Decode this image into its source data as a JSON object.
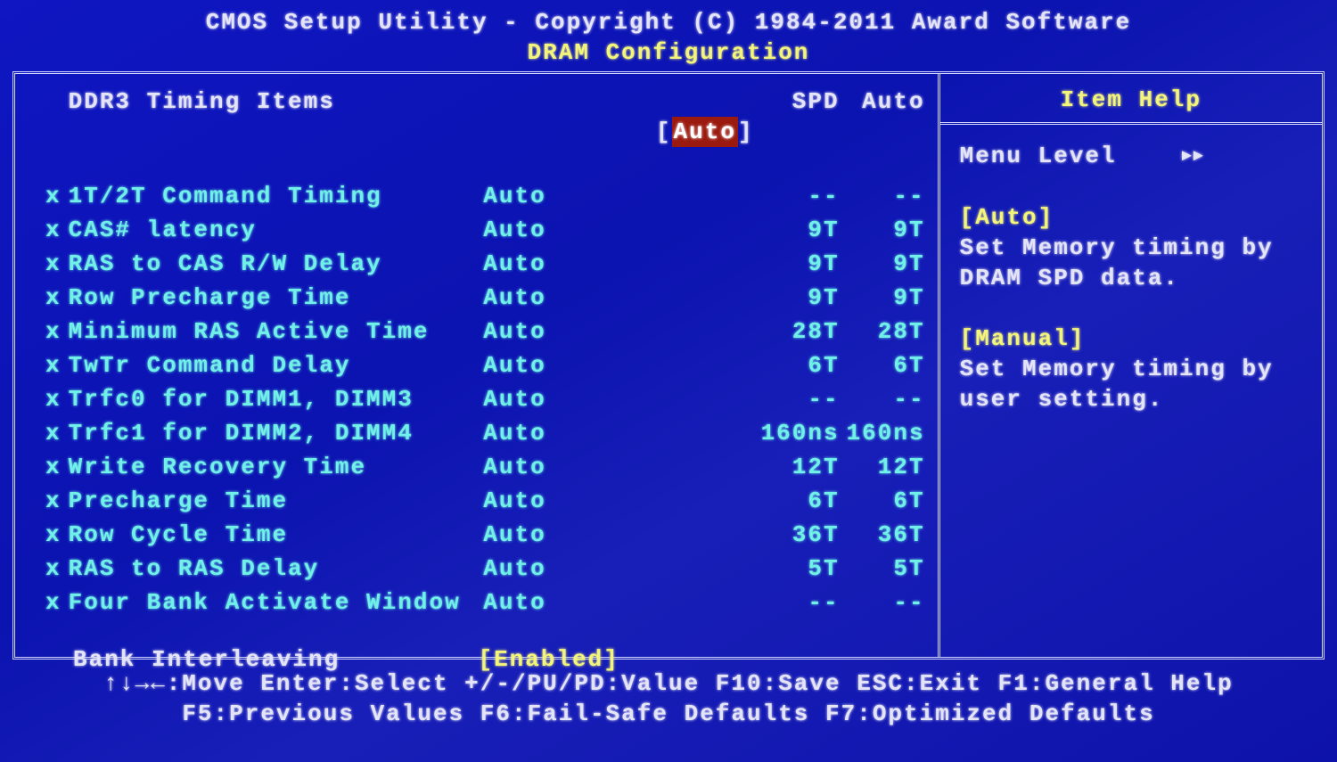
{
  "title": {
    "line1": "CMOS Setup Utility - Copyright (C) 1984-2011 Award Software",
    "line2": "DRAM Configuration"
  },
  "columns": {
    "name": "DDR3 Timing Items",
    "value_prefix": "[",
    "value": "Auto",
    "value_suffix": "]",
    "spd": "SPD",
    "auto": "Auto"
  },
  "rows": [
    {
      "label": "1T/2T Command Timing",
      "value": "Auto",
      "spd": "--",
      "auto": "--"
    },
    {
      "label": "CAS# latency",
      "value": "Auto",
      "spd": "9T",
      "auto": "9T"
    },
    {
      "label": "RAS to CAS R/W Delay",
      "value": "Auto",
      "spd": "9T",
      "auto": "9T"
    },
    {
      "label": "Row Precharge Time",
      "value": "Auto",
      "spd": "9T",
      "auto": "9T"
    },
    {
      "label": "Minimum RAS Active Time",
      "value": "Auto",
      "spd": "28T",
      "auto": "28T"
    },
    {
      "label": "TwTr Command Delay",
      "value": "Auto",
      "spd": "6T",
      "auto": "6T"
    },
    {
      "label": "Trfc0 for DIMM1, DIMM3",
      "value": "Auto",
      "spd": "--",
      "auto": "--"
    },
    {
      "label": "Trfc1 for DIMM2, DIMM4",
      "value": "Auto",
      "spd": "160ns",
      "auto": "160ns"
    },
    {
      "label": "Write Recovery Time",
      "value": "Auto",
      "spd": "12T",
      "auto": "12T"
    },
    {
      "label": "Precharge Time",
      "value": "Auto",
      "spd": "6T",
      "auto": "6T"
    },
    {
      "label": "Row Cycle Time",
      "value": "Auto",
      "spd": "36T",
      "auto": "36T"
    },
    {
      "label": "RAS to RAS Delay",
      "value": "Auto",
      "spd": "5T",
      "auto": "5T"
    },
    {
      "label": "Four Bank Activate Window",
      "value": "Auto",
      "spd": "--",
      "auto": "--"
    }
  ],
  "bank": {
    "label": "Bank Interleaving",
    "value": "[Enabled]"
  },
  "help": {
    "title": "Item Help",
    "menu_level_label": "Menu Level",
    "menu_level_arrows": "▸▸",
    "sections": [
      {
        "heading": "[Auto]",
        "text": "Set Memory timing by DRAM SPD data."
      },
      {
        "heading": "[Manual]",
        "text": "Set Memory timing by user setting."
      }
    ]
  },
  "footer": {
    "line1": "↑↓→←:Move   Enter:Select   +/-/PU/PD:Value   F10:Save   ESC:Exit   F1:General Help",
    "line2": "F5:Previous Values   F6:Fail-Safe Defaults   F7:Optimized Defaults"
  },
  "marker": "x"
}
